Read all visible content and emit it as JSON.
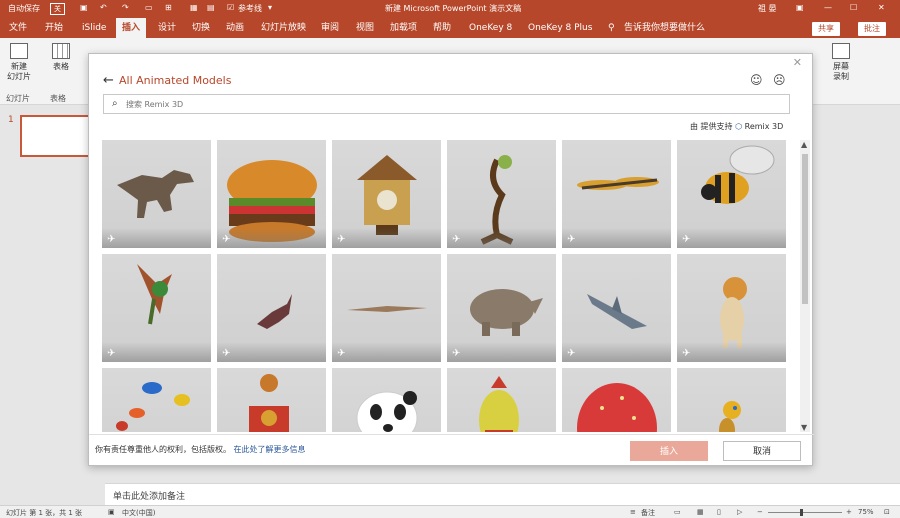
{
  "titlebar": {
    "autosave": "自动保存",
    "autosave_state": "关",
    "reference_line": "参考线",
    "doc_title": "新建 Microsoft PowerPoint 演示文稿",
    "user": "祖 晏"
  },
  "tabs": [
    "文件",
    "开始",
    "iSlide",
    "插入",
    "设计",
    "切换",
    "动画",
    "幻灯片放映",
    "审阅",
    "视图",
    "加载项",
    "帮助",
    "OneKey 8",
    "OneKey 8 Plus"
  ],
  "active_tab": "插入",
  "tell_me": "告诉我你想要做什么",
  "share": "共享",
  "comment": "批注",
  "ribbon": {
    "new_slide": "新建\n幻灯片",
    "table": "表格",
    "group_slides": "幻灯片",
    "group_tables": "表格",
    "screen_record": "屏幕\n录制"
  },
  "slide_panel": {
    "number": "1"
  },
  "dialog": {
    "title": "All Animated Models",
    "search_placeholder": "搜索 Remix 3D",
    "powered_prefix": "由 提供支持",
    "powered_brand": "Remix 3D",
    "legal_text": "你有责任尊重他人的权利，包括版权。",
    "learn_more": "在此处了解更多信息",
    "insert_button": "插入",
    "cancel_button": "取消",
    "models": [
      "dinosaur",
      "burger",
      "cuckoo-clock",
      "tree-creature",
      "dragonfly",
      "bee",
      "parrot",
      "small-dragon",
      "pterodactyl",
      "rhino",
      "shark",
      "shiba-dog",
      "tropical-fish",
      "robot",
      "panda",
      "pear-character",
      "strawberry",
      "yellow-bird"
    ]
  },
  "notes": {
    "placeholder": "单击此处添加备注"
  },
  "status": {
    "slide_info": "幻灯片 第 1 张，共 1 张",
    "language": "中文(中国)",
    "notes_btn": "备注",
    "zoom": "75%"
  },
  "colors": {
    "accent": "#b7472a",
    "link": "#2b579a"
  }
}
